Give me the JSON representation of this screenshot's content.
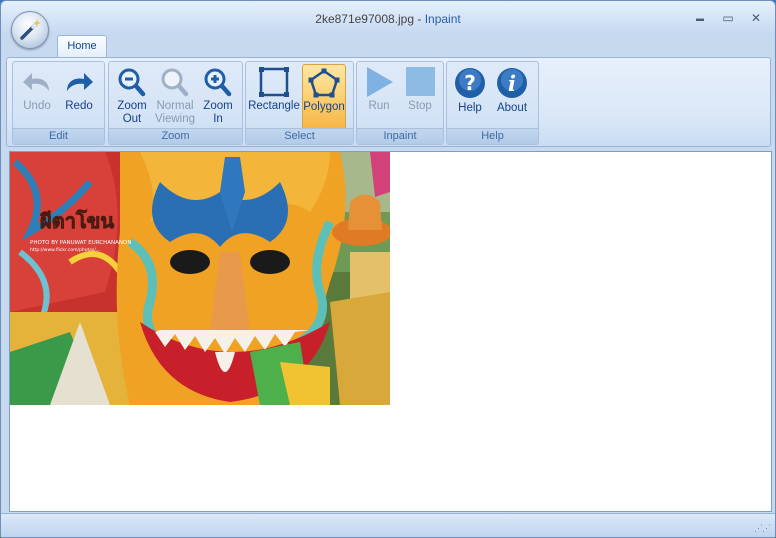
{
  "window": {
    "file_name": "2ke871e97008.jpg",
    "separator": " - ",
    "app_name": "Inpaint",
    "controls": {
      "minimize": "▬",
      "maximize": "▭",
      "close": "✕"
    }
  },
  "tabs": [
    {
      "label": "Home"
    }
  ],
  "ribbon": {
    "edit": {
      "label": "Edit",
      "undo": "Undo",
      "redo": "Redo"
    },
    "zoom": {
      "label": "Zoom",
      "zoom_out": [
        "Zoom",
        "Out"
      ],
      "normal": [
        "Normal",
        "Viewing"
      ],
      "zoom_in": [
        "Zoom",
        "In"
      ]
    },
    "select": {
      "label": "Select",
      "rectangle": "Rectangle",
      "polygon": "Polygon"
    },
    "inpaint": {
      "label": "Inpaint",
      "run": "Run",
      "stop": "Stop"
    },
    "help": {
      "label": "Help",
      "help": "Help",
      "about": "About"
    }
  },
  "photo": {
    "watermark_title": "ผีตาโขน",
    "watermark_credit": "PHOTO BY PANUWAT EURCHANANON",
    "watermark_url": "http://www.flickr.com/photos/..."
  },
  "colors": {
    "accent": "#15428b",
    "active": "#fbd37a",
    "icon_blue": "#1f5fa8"
  },
  "statusbar": {
    "grip": "⋰⋰"
  }
}
